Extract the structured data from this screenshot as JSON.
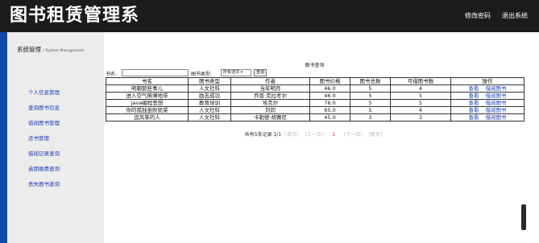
{
  "header": {
    "title": "图书租赁管理系",
    "links": [
      "修改密码",
      "退出系统"
    ]
  },
  "sidebar": {
    "title": "系统管理",
    "subtitle": "System Management",
    "items": [
      {
        "label": "个人信息管理"
      },
      {
        "label": "查询图书信息"
      },
      {
        "label": "借阅图书管理"
      },
      {
        "label": "还书管理"
      },
      {
        "label": "借阅记录查询"
      },
      {
        "label": "逾期缴费查询"
      },
      {
        "label": "丢失图书查询"
      }
    ]
  },
  "panel": {
    "title": "图书查询"
  },
  "search": {
    "name_label": "书名:",
    "name_value": "",
    "type_label": "图书类型:",
    "type_value": "所有选项 ▾",
    "button": "查询"
  },
  "table": {
    "headers": [
      "书名",
      "图书类型",
      "作者",
      "图书价格",
      "图书总数",
      "可借图书数",
      "操作"
    ],
    "rows": [
      {
        "name": "明朝那些事儿",
        "type": "人文社科",
        "author": "当年明月",
        "price": "46.0",
        "total": "5",
        "available": "4"
      },
      {
        "name": "进入空气稀薄地带",
        "type": "励志成功",
        "author": "乔恩·克拉考尔",
        "price": "46.0",
        "total": "5",
        "available": "5"
      },
      {
        "name": "java编程思想",
        "type": "教育培训",
        "author": "埃克尔",
        "price": "76.0",
        "total": "5",
        "available": "5"
      },
      {
        "name": "你的孤独虽败犹荣",
        "type": "人文社科",
        "author": "刘同",
        "price": "65.0",
        "total": "5",
        "available": "4"
      },
      {
        "name": "追风筝的人",
        "type": "人文社科",
        "author": "卡勒德·胡赛尼",
        "price": "45.0",
        "total": "3",
        "available": "3"
      }
    ],
    "op_view": "查看",
    "op_borrow": "借阅图书"
  },
  "pager": {
    "summary": "共有5条记录 1/1",
    "first": "[首页]",
    "prev": "[上一页]",
    "current": "1",
    "next": "[下一页]",
    "last": "[尾页]"
  }
}
